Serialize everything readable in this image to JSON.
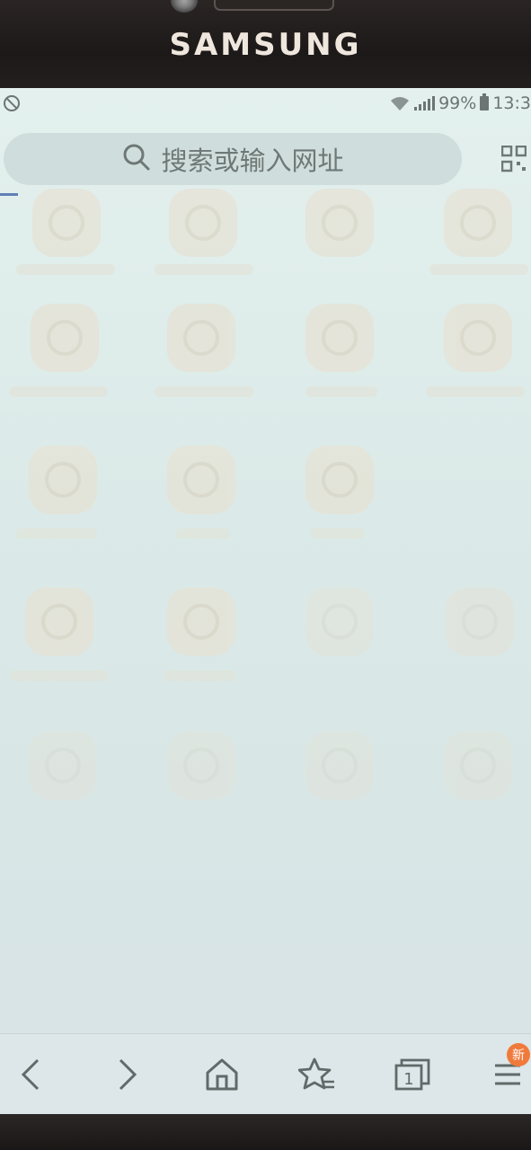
{
  "device": {
    "brand": "SAMSUNG"
  },
  "status_bar": {
    "battery_percent": "99%",
    "time": "13:3"
  },
  "search": {
    "placeholder": "搜索或输入网址"
  },
  "toolbar": {
    "items": [
      "back-icon",
      "forward-icon",
      "home-icon",
      "bookmark-star-icon",
      "tabs-icon",
      "menu-icon"
    ],
    "tab_count": "1",
    "menu_badge": "新"
  },
  "colors": {
    "badge": "#f07a3c",
    "tab_indicator": "#5f7fb6"
  }
}
